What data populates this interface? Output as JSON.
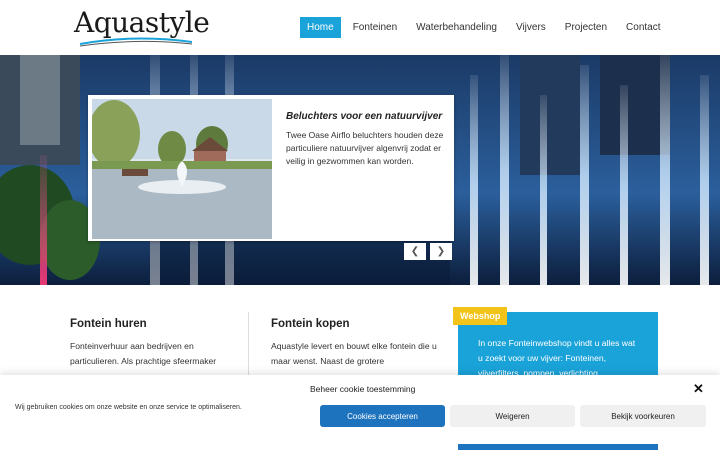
{
  "brand": {
    "logo_text": "Aquastyle"
  },
  "nav": {
    "items": [
      {
        "label": "Home",
        "active": true
      },
      {
        "label": "Fonteinen",
        "active": false
      },
      {
        "label": "Waterbehandeling",
        "active": false
      },
      {
        "label": "Vijvers",
        "active": false
      },
      {
        "label": "Projecten",
        "active": false
      },
      {
        "label": "Contact",
        "active": false
      }
    ]
  },
  "slider": {
    "title": "Beluchters voor een natuurvijver",
    "text": "Twee Oase Airflo beluchters houden deze particuliere natuurvijver algenvrij zodat er veilig in gezwommen kan worden.",
    "prev_icon": "chevron-left-icon",
    "next_icon": "chevron-right-icon"
  },
  "columns": [
    {
      "title": "Fontein huren",
      "text": "Fonteinverhuur aan bedrijven en particulieren. Als prachtige sfeermaker"
    },
    {
      "title": "Fontein kopen",
      "text": "Aquastyle levert en bouwt elke fontein die u maar wenst. Naast de grotere"
    }
  ],
  "webshop": {
    "badge": "Webshop",
    "text": "In onze Fonteinwebshop vindt u alles wat u zoekt voor uw vijver: Fonteinen, vijverfilters, pompen, verlichting"
  },
  "cookie": {
    "title": "Beheer cookie toestemming",
    "message": "Wij gebruiken cookies om onze website en onze service te optimaliseren.",
    "accept": "Cookies accepteren",
    "deny": "Weigeren",
    "prefs": "Bekijk voorkeuren",
    "close": "✕"
  },
  "colors": {
    "accent": "#1aa3d9",
    "badge": "#f2c318",
    "accept_button": "#1e73be"
  }
}
